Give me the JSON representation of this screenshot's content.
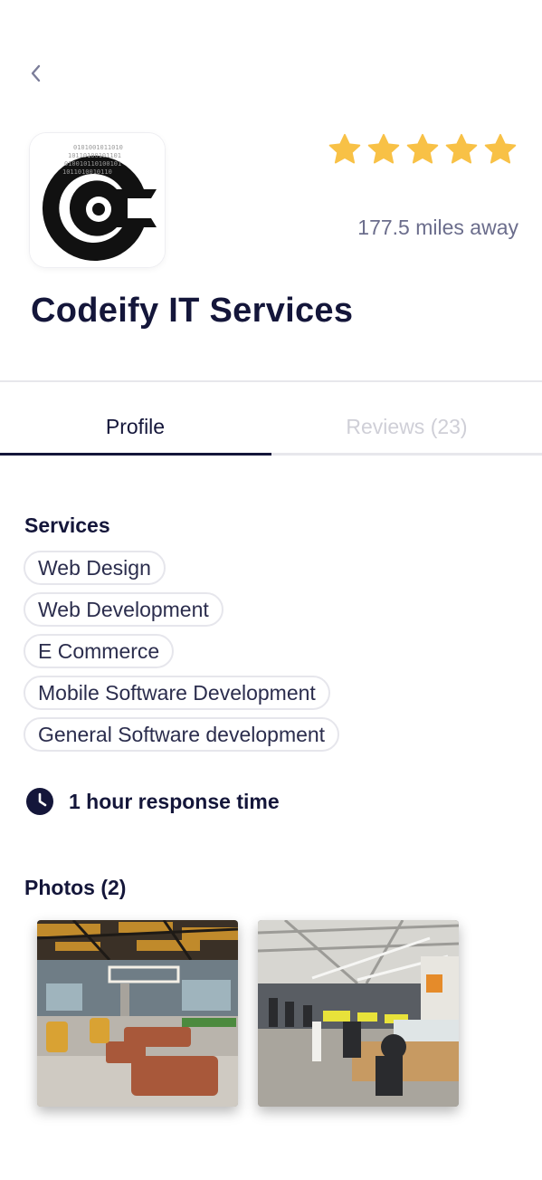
{
  "header": {
    "back_icon": "chevron-left-icon"
  },
  "company": {
    "name": "Codeify IT Services",
    "distance": "177.5 miles away",
    "rating": 5,
    "rating_max": 5,
    "star_color": "#f8c146"
  },
  "tabs": [
    {
      "label": "Profile",
      "active": true
    },
    {
      "label": "Reviews (23)",
      "active": false
    }
  ],
  "services": {
    "title": "Services",
    "items": [
      "Web Design",
      "Web Development",
      "E Commerce",
      "Mobile Software Development",
      "General Software development"
    ]
  },
  "response": {
    "icon": "clock-icon",
    "text": "1 hour response time"
  },
  "photos": {
    "title": "Photos (2)",
    "items": [
      {
        "description_icon": "office-lounge-photo"
      },
      {
        "description_icon": "office-workspace-photo"
      }
    ]
  },
  "colors": {
    "primary_text": "#14163a",
    "muted_text": "#6b6d8c",
    "inactive_tab": "#cfcfd7"
  }
}
